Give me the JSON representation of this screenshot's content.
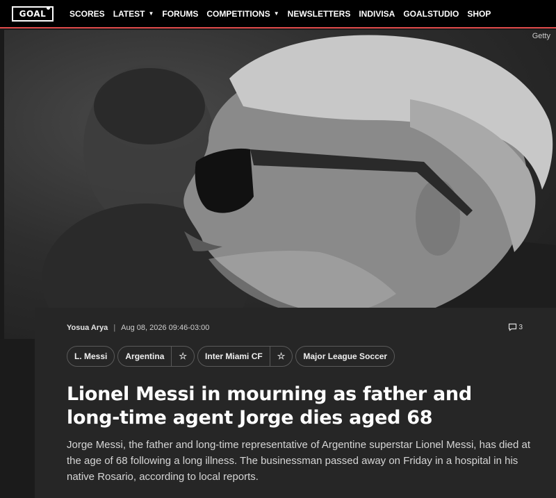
{
  "nav": {
    "logo": "GOAL",
    "items": [
      {
        "label": "SCORES",
        "dropdown": false
      },
      {
        "label": "LATEST",
        "dropdown": true
      },
      {
        "label": "FORUMS",
        "dropdown": false
      },
      {
        "label": "COMPETITIONS",
        "dropdown": true
      },
      {
        "label": "NEWSLETTERS",
        "dropdown": false
      },
      {
        "label": "INDIVISA",
        "dropdown": false
      },
      {
        "label": "GOALSTUDIO",
        "dropdown": false
      },
      {
        "label": "SHOP",
        "dropdown": false
      }
    ],
    "accent_color": "#e04a4a"
  },
  "hero": {
    "credit": "Getty"
  },
  "article": {
    "author": "Yosua Arya",
    "separator": "|",
    "date": "Aug 08, 2026 09:46-03:00",
    "comment_count": "3",
    "tags": [
      {
        "label": "L. Messi",
        "star": false
      },
      {
        "label": "Argentina",
        "star": true
      },
      {
        "label": "Inter Miami CF",
        "star": true
      },
      {
        "label": "Major League Soccer",
        "star": false
      }
    ],
    "star_glyph": "☆",
    "headline": "Lionel Messi in mourning as father and long-time agent Jorge dies aged 68",
    "lede": "Jorge Messi, the father and long-time representative of Argentine superstar Lionel Messi, has died at the age of 68 following a long illness. The businessman passed away on Friday in a hospital in his native Rosario, according to local reports."
  }
}
